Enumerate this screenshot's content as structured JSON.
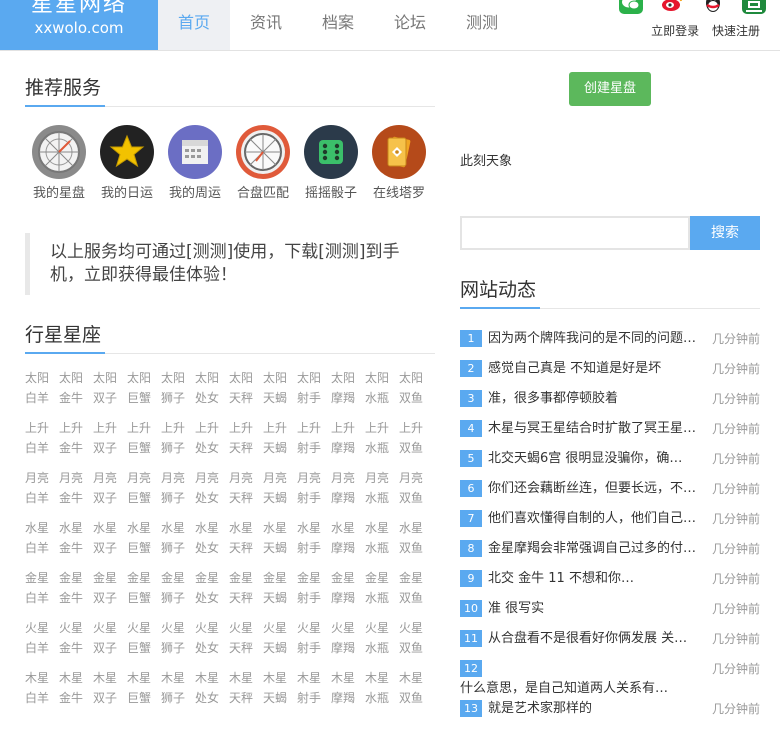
{
  "logo": {
    "name": "星星网络",
    "domain": "xxwolo.com"
  },
  "nav": [
    "首页",
    "资讯",
    "档案",
    "论坛",
    "测测"
  ],
  "auth": {
    "login": "立即登录",
    "register": "快速注册"
  },
  "services_title": "推荐服务",
  "services": [
    {
      "label": "我的星盘",
      "icon": "astrolabe-icon"
    },
    {
      "label": "我的日运",
      "icon": "star-icon"
    },
    {
      "label": "我的周运",
      "icon": "calendar-icon"
    },
    {
      "label": "合盘匹配",
      "icon": "astrolabe-match-icon"
    },
    {
      "label": "摇摇骰子",
      "icon": "dice-icon"
    },
    {
      "label": "在线塔罗",
      "icon": "tarot-icon"
    }
  ],
  "notice": "以上服务均可通过[测测]使用，下载[测测]到手机，立即获得最佳体验！",
  "planets_title": "行星星座",
  "planets": [
    "太阳",
    "上升",
    "月亮",
    "水星",
    "金星",
    "火星",
    "木星"
  ],
  "signs": [
    "白羊",
    "金牛",
    "双子",
    "巨蟹",
    "狮子",
    "处女",
    "天秤",
    "天蝎",
    "射手",
    "摩羯",
    "水瓶",
    "双鱼"
  ],
  "create_btn": "创建星盘",
  "now_sky": "此刻天象",
  "search_btn": "搜索",
  "news_title": "网站动态",
  "news": [
    {
      "num": "1",
      "text": "因为两个牌阵我问的是不同的问题…",
      "time": "几分钟前"
    },
    {
      "num": "2",
      "text": "感觉自己真是 不知道是好是坏",
      "time": "几分钟前"
    },
    {
      "num": "3",
      "text": "准，很多事都停顿胶着",
      "time": "几分钟前"
    },
    {
      "num": "4",
      "text": "木星与冥王星结合时扩散了冥王星…",
      "time": "几分钟前"
    },
    {
      "num": "5",
      "text": "北交天蝎6宫 很明显没骗你，确…",
      "time": "几分钟前"
    },
    {
      "num": "6",
      "text": "你们还会藕断丝连，但要长远，不…",
      "time": "几分钟前"
    },
    {
      "num": "7",
      "text": "他们喜欢懂得自制的人，他们自己…",
      "time": "几分钟前"
    },
    {
      "num": "8",
      "text": "金星摩羯会非常强调自己过多的付…",
      "time": "几分钟前"
    },
    {
      "num": "9",
      "text": "北交 金牛 11 不想和你…",
      "time": "几分钟前"
    },
    {
      "num": "10",
      "text": "准 很写实",
      "time": "几分钟前"
    },
    {
      "num": "11",
      "text": "从合盘看不是很看好你俩发展 关…",
      "time": "几分钟前"
    },
    {
      "num": "12",
      "text": "什么意思，是自己知道两人关系有…",
      "time": "几分钟前"
    },
    {
      "num": "13",
      "text": "就是艺术家那样的",
      "time": "几分钟前"
    }
  ]
}
